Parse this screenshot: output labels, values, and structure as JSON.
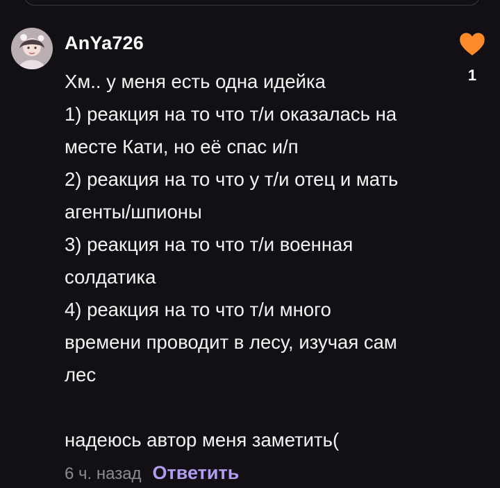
{
  "colors": {
    "background": "#121014",
    "like_heart": "#ff8a2a",
    "reply_accent": "#b19cf0",
    "timestamp": "#8d8a92"
  },
  "comment": {
    "avatar_icon": "avatar-photo",
    "username": "AnYa726",
    "text": "Хм.. у меня есть одна идейка\n1) реакция на то что т/и оказалась на\nместе Кати, но её спас и/п\n2) реакция на то что у т/и отец и мать\nагенты/шпионы\n3) реакция на то что т/и военная\nсолдатика\n4) реакция на то что т/и много\nвремени проводит в лесу, изучая сам\nлес\n\nнадеюсь автор меня заметить(",
    "like_icon": "heart-icon",
    "like_count": "1",
    "timestamp": "6 ч. назад",
    "reply_label": "Ответить"
  }
}
